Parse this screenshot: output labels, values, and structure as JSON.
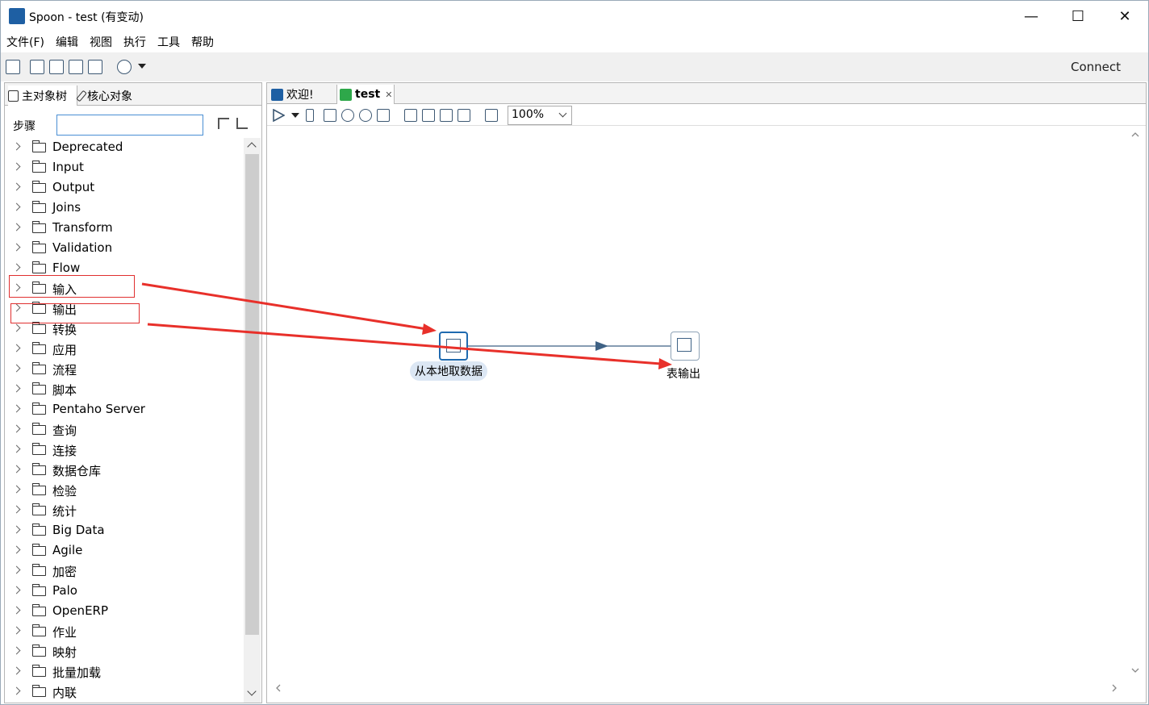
{
  "window": {
    "title": "Spoon - test (有变动)",
    "controls": {
      "minimize": "—",
      "maximize": "☐",
      "close": "✕"
    }
  },
  "menu": [
    "文件(F)",
    "编辑",
    "视图",
    "执行",
    "工具",
    "帮助"
  ],
  "toolbar": {
    "connect_label": "Connect",
    "icons": [
      "new-file-icon",
      "open-icon",
      "explore-icon",
      "save-icon",
      "save-as-icon",
      "layers-icon",
      "dropdown-icon"
    ]
  },
  "left_panel": {
    "tabs": [
      "主对象树",
      "核心对象"
    ],
    "steps_label": "步骤",
    "search_value": "",
    "tree": [
      "Deprecated",
      "Input",
      "Output",
      "Joins",
      "Transform",
      "Validation",
      "Flow",
      "输入",
      "输出",
      "转换",
      "应用",
      "流程",
      "脚本",
      "Pentaho Server",
      "查询",
      "连接",
      "数据仓库",
      "检验",
      "统计",
      "Big Data",
      "Agile",
      "加密",
      "Palo",
      "OpenERP",
      "作业",
      "映射",
      "批量加载",
      "内联"
    ]
  },
  "right_panel": {
    "tabs": [
      {
        "label": "欢迎!",
        "close": ""
      },
      {
        "label": "test",
        "close": "✕"
      }
    ],
    "zoom": "100%",
    "steps": [
      {
        "label": "从本地取数据"
      },
      {
        "label": "表输出"
      }
    ]
  },
  "colors": {
    "accent": "#1f6ab0",
    "annotation_red": "#e8302a",
    "hop": "#3f6285"
  }
}
